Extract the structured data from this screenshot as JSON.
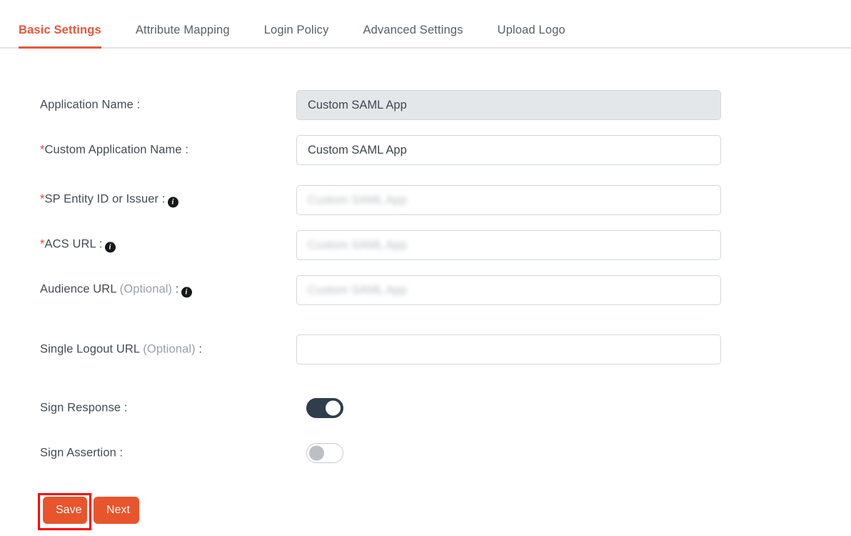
{
  "tabs": [
    {
      "label": "Basic Settings",
      "active": true
    },
    {
      "label": "Attribute Mapping",
      "active": false
    },
    {
      "label": "Login Policy",
      "active": false
    },
    {
      "label": "Advanced Settings",
      "active": false
    },
    {
      "label": "Upload Logo",
      "active": false
    }
  ],
  "form": {
    "application_name": {
      "label": "Application Name :",
      "value": "Custom SAML App",
      "disabled": true
    },
    "custom_application_name": {
      "required_mark": "*",
      "label": "Custom Application Name :",
      "value": "Custom SAML App"
    },
    "sp_entity_id": {
      "required_mark": "*",
      "label": "SP Entity ID or Issuer :",
      "info_icon": "info-icon",
      "placeholder": "Custom SAML App",
      "value": ""
    },
    "acs_url": {
      "required_mark": "*",
      "label": "ACS URL :",
      "info_icon": "info-icon",
      "placeholder": "Custom SAML App",
      "value": ""
    },
    "audience_url": {
      "label": "Audience URL ",
      "optional": "(Optional)",
      "label_suffix": " :",
      "info_icon": "info-icon",
      "placeholder": "Custom SAML App",
      "value": ""
    },
    "single_logout_url": {
      "label": "Single Logout URL ",
      "optional": "(Optional)",
      "label_suffix": " :",
      "placeholder": "",
      "value": ""
    },
    "sign_response": {
      "label": "Sign Response :",
      "state": "on"
    },
    "sign_assertion": {
      "label": "Sign Assertion :",
      "state": "off"
    }
  },
  "buttons": {
    "save": "Save",
    "next": "Next"
  },
  "colors": {
    "accent_orange": "#e2593a",
    "button_orange": "#e8552c",
    "annotation_red": "#ff0000",
    "toggle_on": "#2f3e4d",
    "required_red": "#e8483a",
    "label_text": "#444c55",
    "tab_inactive": "#55606b",
    "disabled_field_bg": "#e4e7ea"
  }
}
